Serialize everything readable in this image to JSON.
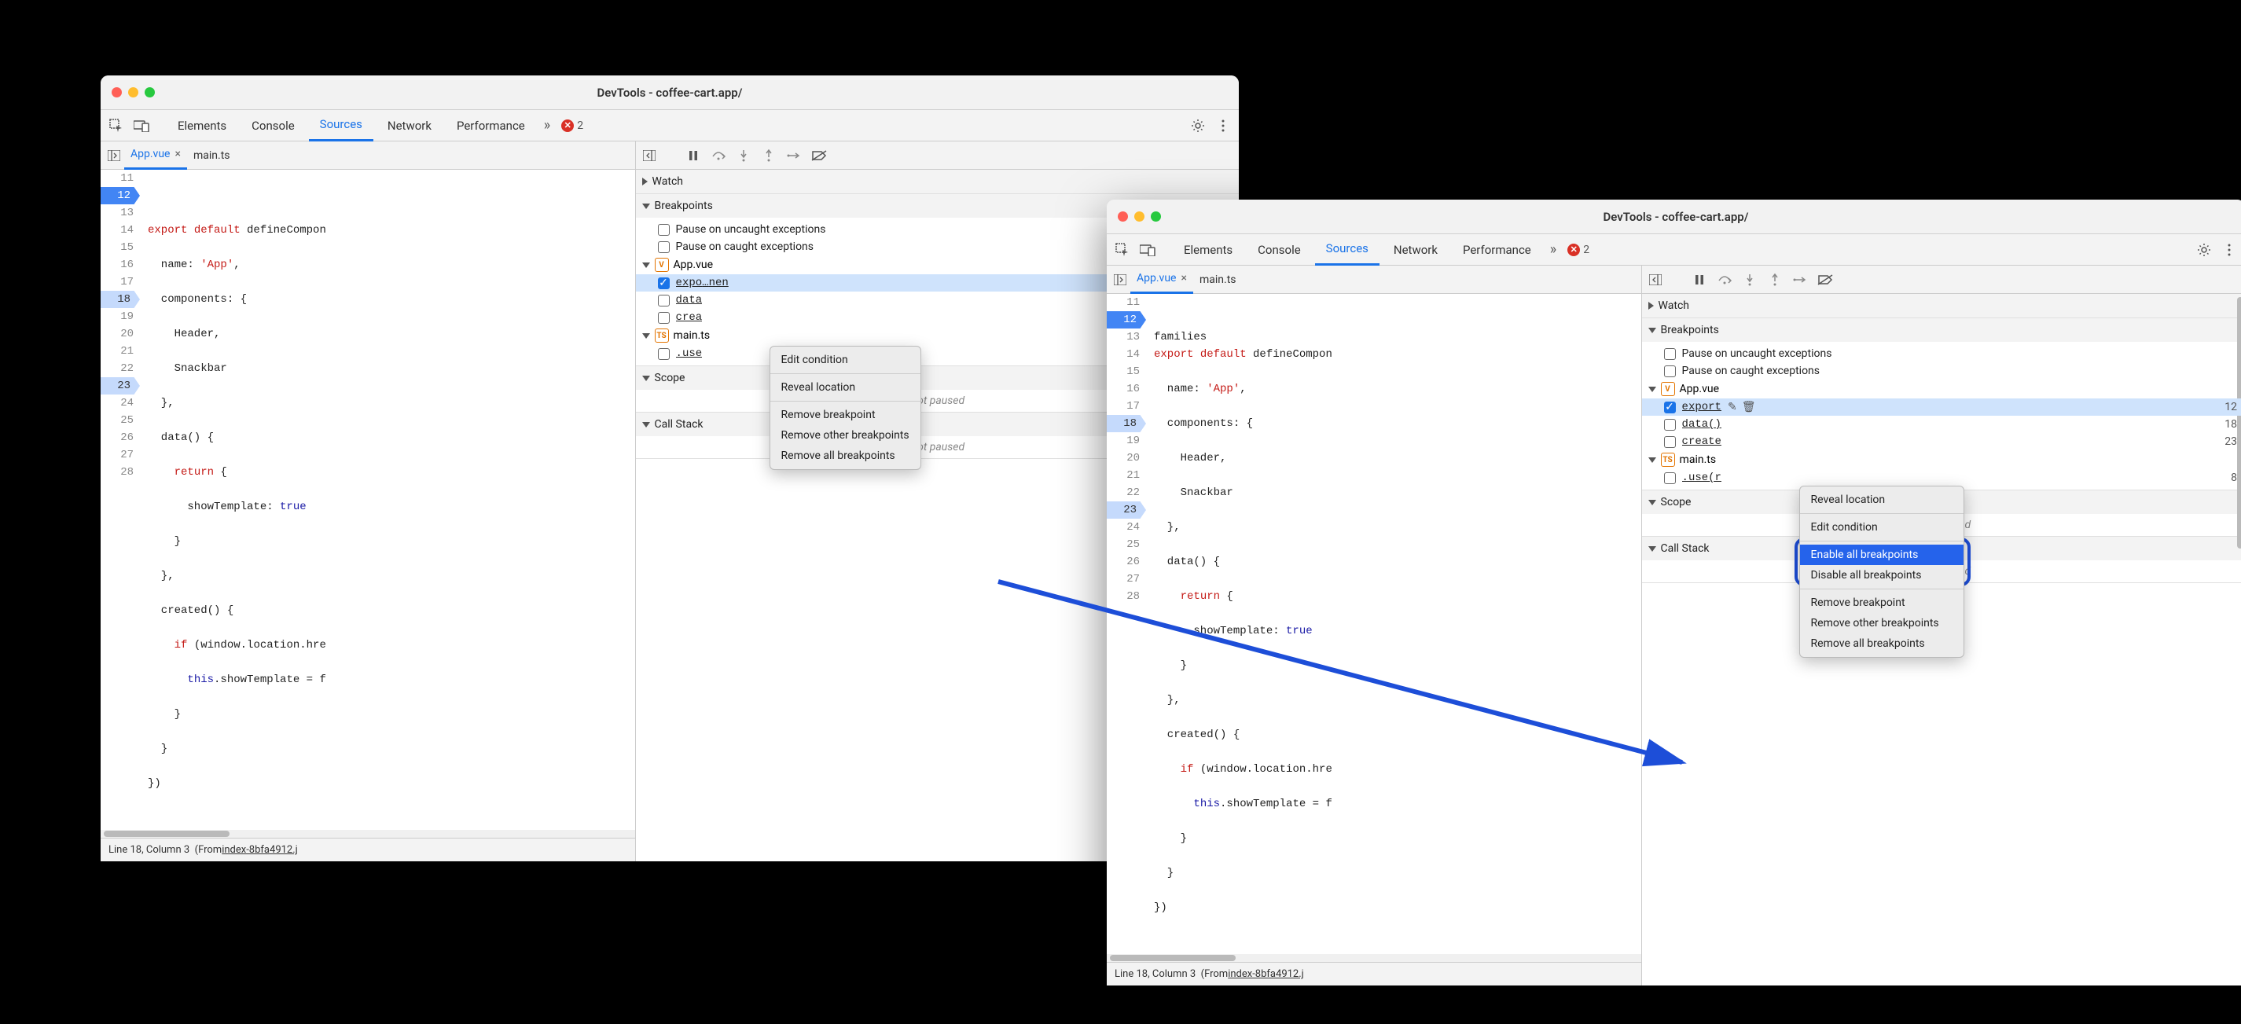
{
  "win_title": "DevTools - coffee-cart.app/",
  "tabs": {
    "elements": "Elements",
    "console": "Console",
    "sources": "Sources",
    "network": "Network",
    "performance": "Performance"
  },
  "err_count": "2",
  "files": {
    "app": "App.vue",
    "main": "main.ts"
  },
  "gutter": [
    "11",
    "12",
    "13",
    "14",
    "15",
    "16",
    "17",
    "18",
    "19",
    "20",
    "21",
    "22",
    "23",
    "24",
    "25",
    "26",
    "27",
    "28"
  ],
  "code": {
    "l12a": "export ",
    "l12b": "default ",
    "l12c": "defineCompon",
    "l13a": "  name: ",
    "l13b": "'App'",
    "l13c": ",",
    "l14": "  components: {",
    "l15": "    Header,",
    "l16": "    Snackbar",
    "l17": "  },",
    "l18": "  data() {",
    "l19a": "    ",
    "l19b": "return ",
    "l19c": "{",
    "l20a": "      showTemplate: ",
    "l20b": "true",
    "l21": "    }",
    "l22": "  },",
    "l23": "  created() {",
    "l24a": "    ",
    "l24b": "if ",
    "l24c": "(window.location.hre",
    "l25a": "      ",
    "l25b": "this",
    "l25c": ".showTemplate = f",
    "l26": "    }",
    "l27": "  }",
    "l28": "})"
  },
  "sections": {
    "watch": "Watch",
    "breakpoints": "Breakpoints",
    "scope": "Scope",
    "callstack": "Call Stack"
  },
  "bp_opts": {
    "uncaught": "Pause on uncaught exceptions",
    "caught": "Pause on caught exceptions"
  },
  "bp_groups": {
    "app": "App.vue",
    "main": "main.ts"
  },
  "bp_items": {
    "exp_snip": "expo",
    "exp_tail": "nen",
    "exp_snip_b": "export",
    "data_snip": "data",
    "data_snip_b": "data()",
    "created_snip": "crea",
    "created_snip_b": "create",
    "use_snip": ".use",
    "use_snip_b": ".use(r"
  },
  "bp_lines": {
    "l12": "12",
    "l18": "18",
    "l23": "23",
    "l8": "8"
  },
  "not_paused": "Not paused",
  "status": {
    "pos": "Line 18, Column 3",
    "from": "(From ",
    "file": "index-8bfa4912.j"
  },
  "menu_a": {
    "edit": "Edit condition",
    "reveal": "Reveal location",
    "remove": "Remove breakpoint",
    "remove_other": "Remove other breakpoints",
    "remove_all": "Remove all breakpoints"
  },
  "menu_b": {
    "reveal": "Reveal location",
    "edit": "Edit condition",
    "enable_all": "Enable all breakpoints",
    "disable_all": "Disable all breakpoints",
    "remove": "Remove breakpoint",
    "remove_other": "Remove other breakpoints",
    "remove_all": "Remove all breakpoints"
  }
}
